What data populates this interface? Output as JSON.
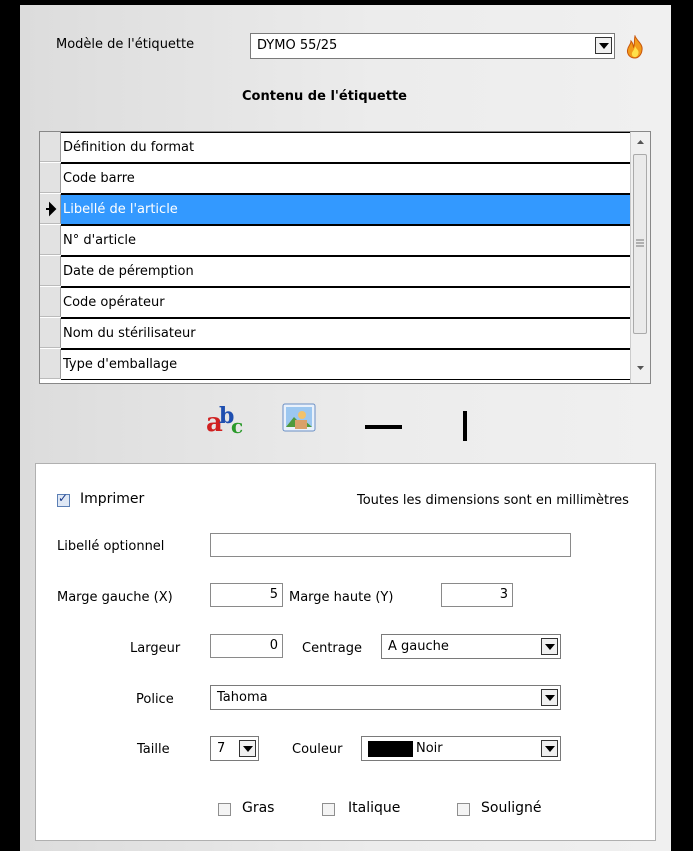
{
  "header": {
    "model_label": "Modèle de l'étiquette",
    "model_value": "DYMO 55/25",
    "content_title": "Contenu de l'étiquette"
  },
  "grid": {
    "rows": [
      {
        "label": "Définition du format",
        "selected": false
      },
      {
        "label": "Code barre",
        "selected": false
      },
      {
        "label": "Libellé de l'article",
        "selected": true
      },
      {
        "label": "N° d'article",
        "selected": false
      },
      {
        "label": "Date de péremption",
        "selected": false
      },
      {
        "label": "Code opérateur",
        "selected": false
      },
      {
        "label": "Nom du stérilisateur",
        "selected": false
      },
      {
        "label": "Type d'emballage",
        "selected": false
      }
    ]
  },
  "toolbar": {
    "icons": [
      "text-abc-icon",
      "image-icon",
      "horizontal-line-icon",
      "vertical-line-icon"
    ]
  },
  "form": {
    "print_label": "Imprimer",
    "print_checked": true,
    "units_note": "Toutes les dimensions sont en millimètres",
    "optional_label": "Libellé optionnel",
    "optional_value": "",
    "margin_left_label": "Marge gauche (X)",
    "margin_left_value": "5",
    "margin_top_label": "Marge haute (Y)",
    "margin_top_value": "3",
    "width_label": "Largeur",
    "width_value": "0",
    "centering_label": "Centrage",
    "centering_value": "A gauche",
    "font_label": "Police",
    "font_value": "Tahoma",
    "size_label": "Taille",
    "size_value": "7",
    "color_label": "Couleur",
    "color_value": "Noir",
    "color_swatch": "#000000",
    "bold_label": "Gras",
    "italic_label": "Italique",
    "underline_label": "Souligné"
  }
}
